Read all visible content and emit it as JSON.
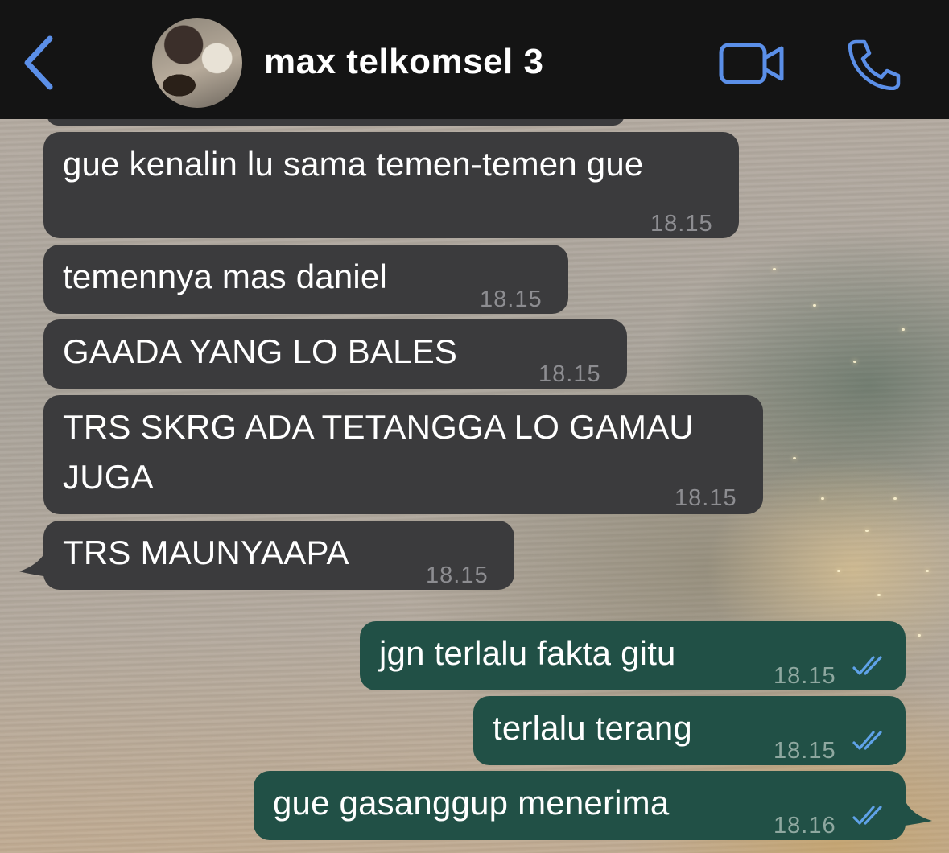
{
  "header": {
    "contact_name": "max telkomsel 3",
    "back_icon": "chevron-left-icon",
    "video_icon": "video-camera-icon",
    "call_icon": "phone-icon",
    "accent_color": "#5b8fe8"
  },
  "messages": [
    {
      "direction": "incoming",
      "text": "gue kenalin lu sama temen-temen gue",
      "time": "18.15"
    },
    {
      "direction": "incoming",
      "text": "temennya mas daniel",
      "time": "18.15"
    },
    {
      "direction": "incoming",
      "text": "GAADA YANG LO BALES",
      "time": "18.15"
    },
    {
      "direction": "incoming",
      "text_line1": "TRS SKRG ADA TETANGGA LO GAMAU",
      "text_line2": "JUGA",
      "time": "18.15"
    },
    {
      "direction": "incoming",
      "text": "TRS MAUNYAAPA",
      "time": "18.15"
    },
    {
      "direction": "outgoing",
      "text": "jgn terlalu fakta gitu",
      "time": "18.15",
      "status_icon": "double-check-icon"
    },
    {
      "direction": "outgoing",
      "text": "terlalu terang",
      "time": "18.15",
      "status_icon": "double-check-icon"
    },
    {
      "direction": "outgoing",
      "text": "gue gasanggup menerima",
      "time": "18.16",
      "status_icon": "double-check-icon"
    }
  ],
  "colors": {
    "incoming_bubble": "#3b3b3d",
    "outgoing_bubble": "#215046",
    "read_ticks": "#5fa2e8"
  }
}
